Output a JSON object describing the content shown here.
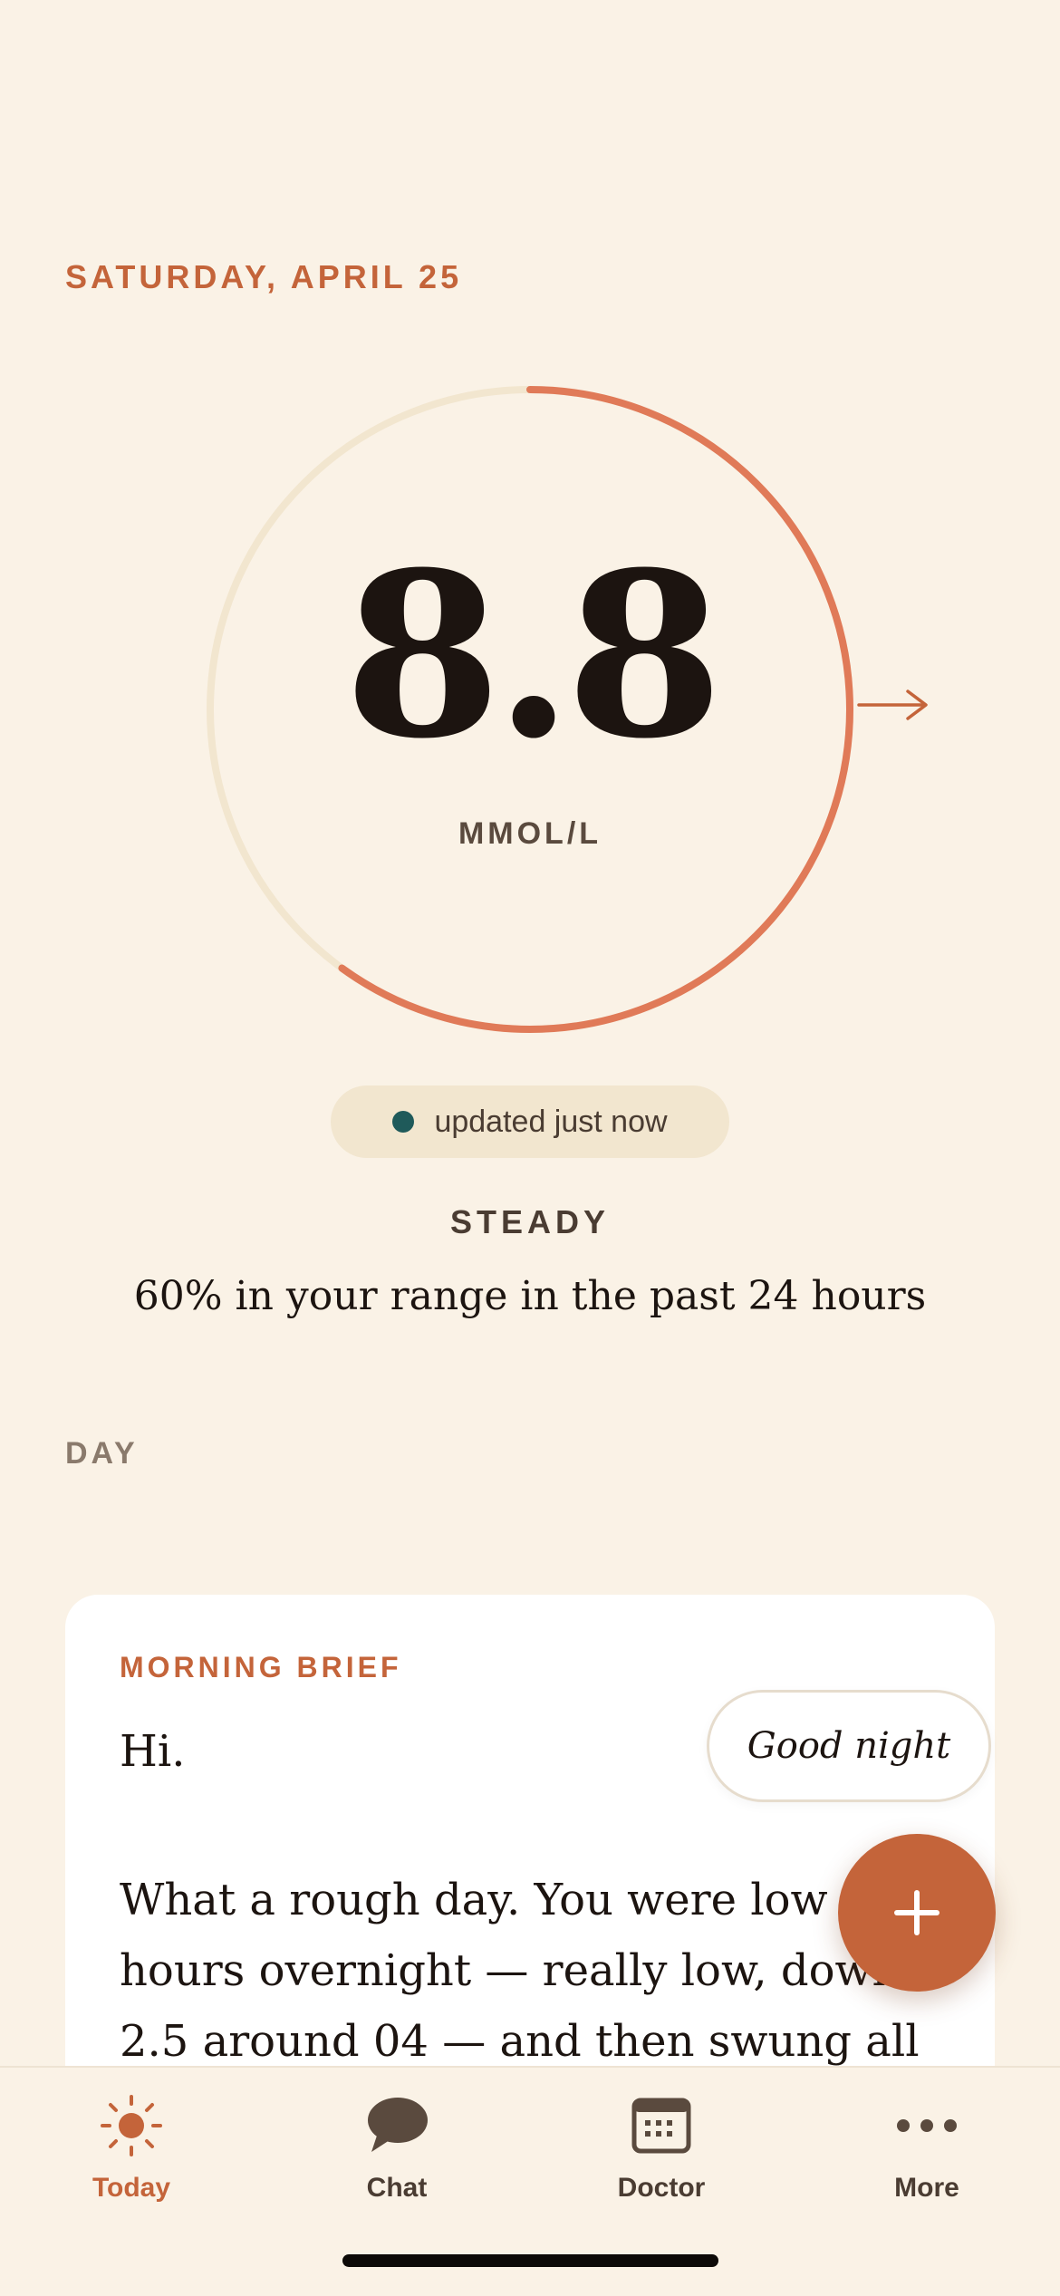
{
  "header": {
    "date": "SATURDAY, APRIL 25"
  },
  "reading": {
    "value": "8.8",
    "unit": "MMOL/L",
    "ring_fill_fraction": 0.6,
    "trend": "right-arrow-icon",
    "updated": "updated just now",
    "status": "STEADY",
    "range_summary": "60% in your range in the past 24 hours"
  },
  "section": {
    "day_label": "DAY"
  },
  "brief": {
    "title": "MORNING BRIEF",
    "greeting": "Hi.",
    "lines": [
      "What a rough day. You were low f",
      "hours overnight — really low, down",
      "2.5 around 04 — and then swung all"
    ]
  },
  "actions": {
    "good_night": "Good night",
    "fab_icon": "plus-icon"
  },
  "tabs": [
    {
      "label": "Today",
      "icon": "sun-icon",
      "active": true
    },
    {
      "label": "Chat",
      "icon": "chat-bubble-icon",
      "active": false
    },
    {
      "label": "Doctor",
      "icon": "calendar-icon",
      "active": false
    },
    {
      "label": "More",
      "icon": "more-dots-icon",
      "active": false
    }
  ],
  "colors": {
    "background": "#faf2e6",
    "accent": "#c4643a",
    "ring_progress": "#e07a58",
    "ring_track": "#f2e6cf",
    "status_dot": "#1f5a5a",
    "text_primary": "#1c1410"
  }
}
